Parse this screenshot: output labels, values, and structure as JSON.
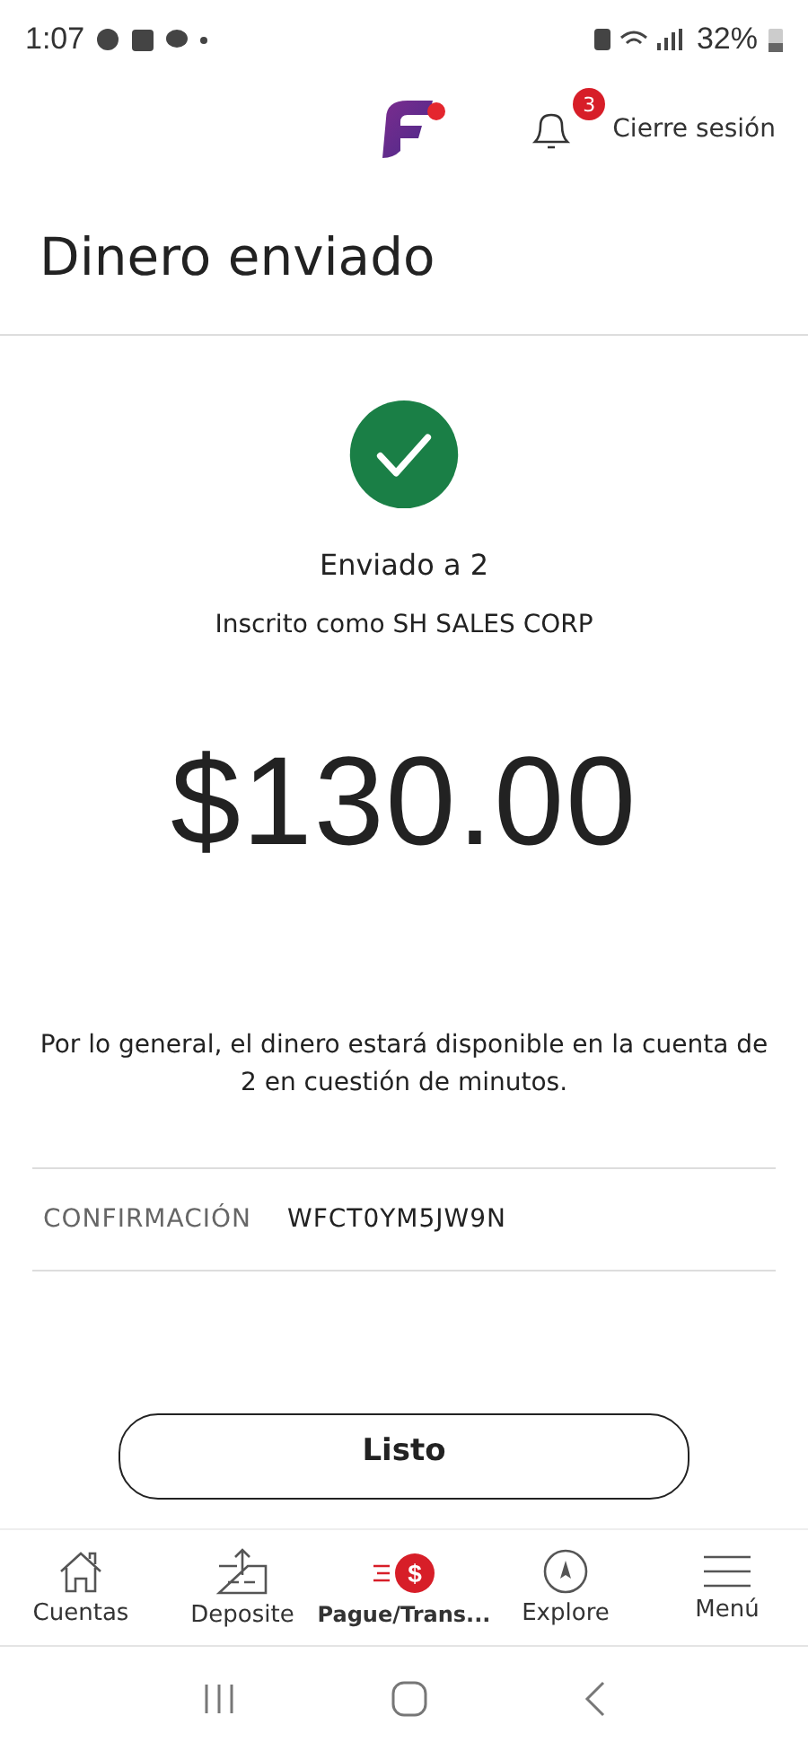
{
  "status_bar": {
    "time": "1:07",
    "battery": "32%"
  },
  "header": {
    "notification_count": "3",
    "logout": "Cierre sesión"
  },
  "title": "Dinero enviado",
  "success": {
    "recipient": "Enviado a 2",
    "enrolled_as": "Inscrito como SH SALES CORP",
    "amount": "$130.00",
    "note": "Por lo general, el dinero estará disponible en la cuenta de 2 en cuestión de minutos."
  },
  "confirmation": {
    "label": "CONFIRMACIÓN",
    "value": "WFCT0YM5JW9N"
  },
  "done_button": "Listo",
  "bottom_nav": [
    {
      "kind": "home",
      "label": "Cuentas",
      "selected": false
    },
    {
      "kind": "deposit",
      "label": "Deposite",
      "selected": false
    },
    {
      "kind": "pay",
      "icon_text": "$",
      "label": "Pague/Trans...",
      "selected": true
    },
    {
      "kind": "explore",
      "label": "Explore",
      "selected": false
    },
    {
      "kind": "menu",
      "label": "Menú",
      "selected": false
    }
  ]
}
